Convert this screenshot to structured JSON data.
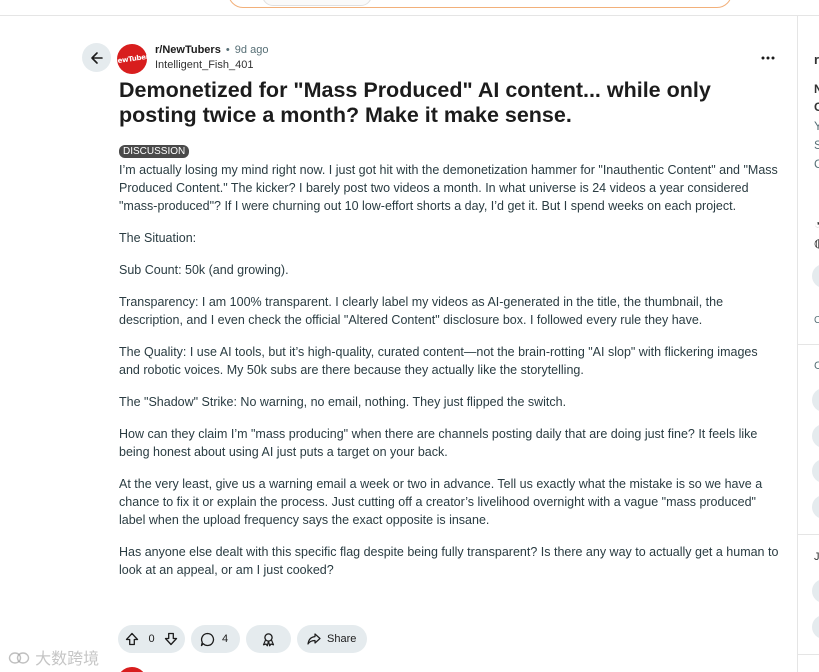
{
  "post": {
    "subreddit": "r/NewTubers",
    "time_ago": "9d ago",
    "author": "Intelligent_Fish_401",
    "avatar_text": "NewTubers",
    "title": "Demonetized for \"Mass Produced\" AI content... while only posting twice a month? Make it make sense.",
    "flair": "DISCUSSION",
    "paragraphs": [
      "I’m actually losing my mind right now. I just got hit with the demonetization hammer for \"Inauthentic Content\" and \"Mass Produced Content.\" The kicker? I barely post two videos a month. In what universe is 24 videos a year considered \"mass-produced\"? If I were churning out 10 low-effort shorts a day, I’d get it. But I spend weeks on each project.",
      "The Situation:",
      "Sub Count: 50k (and growing).",
      "Transparency: I am 100% transparent. I clearly label my videos as AI-generated in the title, the thumbnail, the description, and I even check the official \"Altered Content\" disclosure box. I followed every rule they have.",
      "The Quality: I use AI tools, but it’s high-quality, curated content—not the brain-rotting \"AI slop\" with flickering images and robotic voices. My 50k subs are there because they actually like the storytelling.",
      "The \"Shadow\" Strike: No warning, no email, nothing. They just flipped the switch.",
      "How can they claim I’m \"mass producing\" when there are channels posting daily that are doing just fine? It feels like being honest about using AI just puts a target on your back.",
      "At the very least, give us a warning email a week or two in advance. Tell us exactly what the mistake is so we have a chance to fix it or explain the process. Just cutting off a creator’s livelihood overnight with a vague \"mass produced\" label when the upload frequency says the exact opposite is insane.",
      "Has anyone else dealt with this specific flag despite being fully transparent? Is there any way to actually get a human to look at an appeal, or am I just cooked?"
    ]
  },
  "actions": {
    "vote_count": "0",
    "comment_count": "4",
    "share_label": "Share"
  },
  "icons": {
    "back": "arrow-left-icon",
    "more": "more-horizontal-icon",
    "upvote": "upvote-icon",
    "downvote": "downvote-icon",
    "comment": "comment-icon",
    "award": "award-icon",
    "share": "share-icon"
  },
  "watermark": "大数跨境",
  "sidebar": {
    "fragments": [
      "r",
      "N",
      "C",
      "Y",
      "S",
      "C",
      "C",
      "C",
      "Jo"
    ]
  },
  "colors": {
    "pill_bg": "#e5ebee",
    "avatar": "#d81e1e",
    "flair_bg": "#4a4a4a",
    "search_border": "#f2b07a"
  }
}
